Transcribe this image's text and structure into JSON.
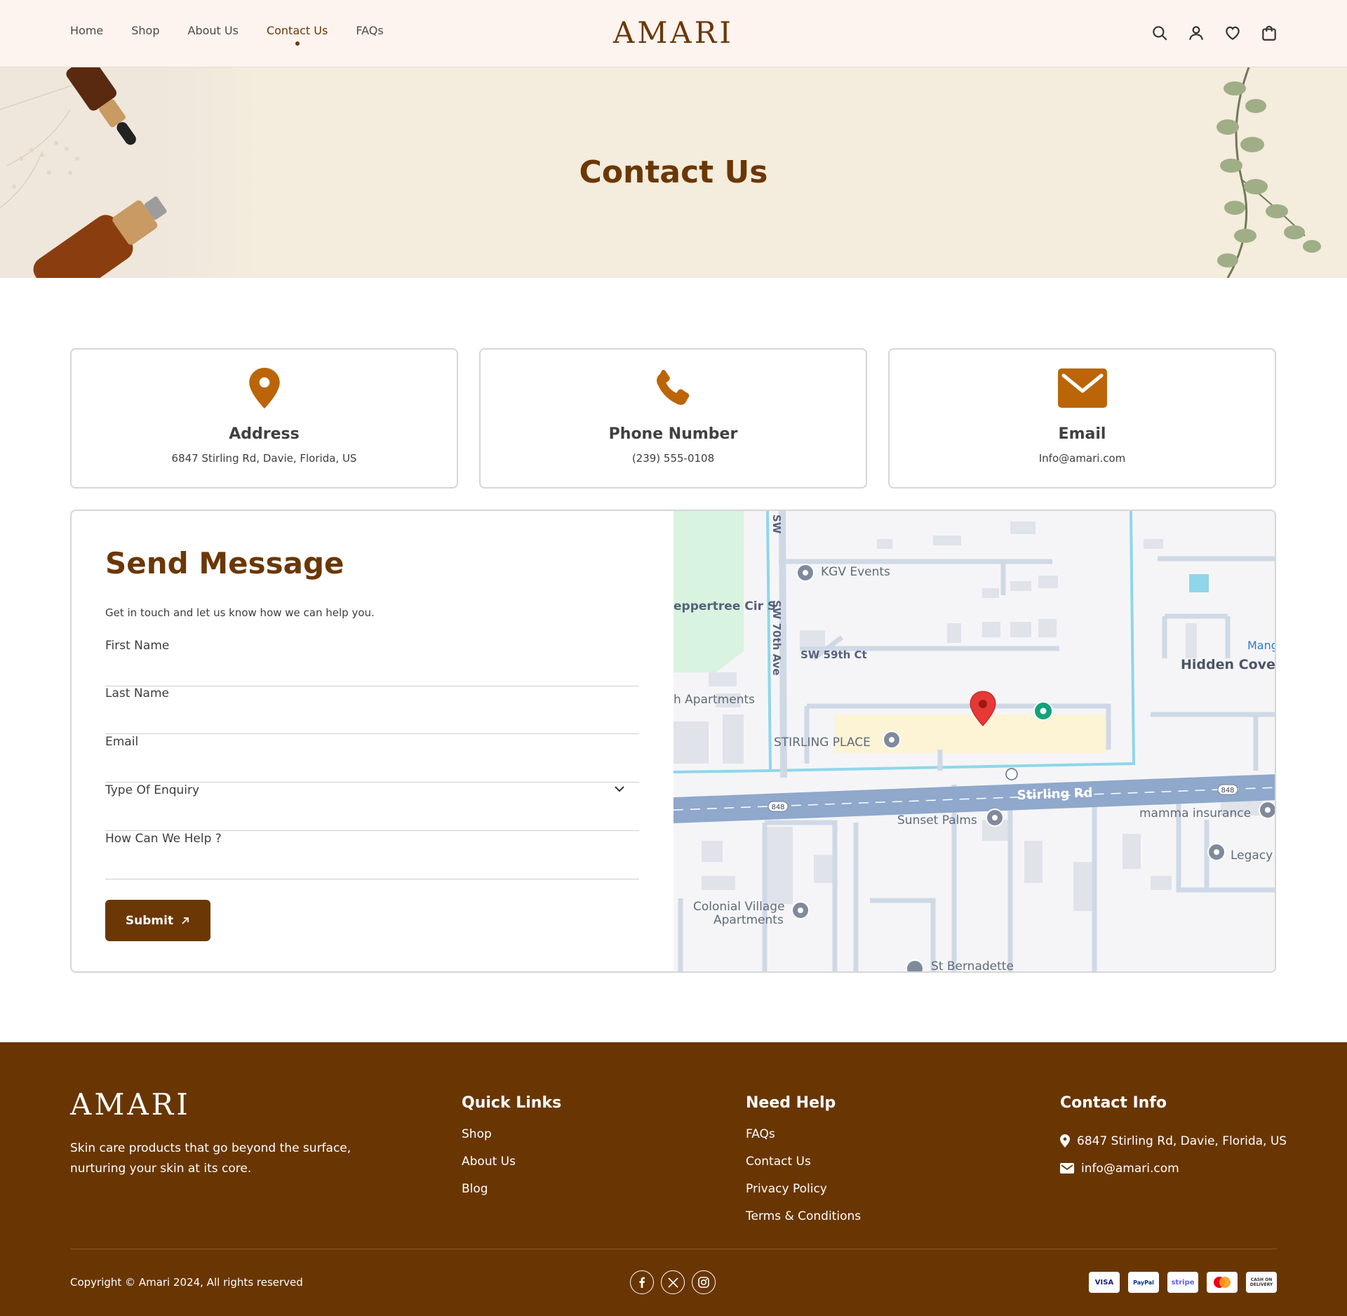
{
  "header": {
    "nav": [
      {
        "label": "Home"
      },
      {
        "label": "Shop"
      },
      {
        "label": "About Us"
      },
      {
        "label": "Contact Us",
        "active": true
      },
      {
        "label": "FAQs"
      }
    ],
    "logo": "AMARI",
    "icons": [
      "search-icon",
      "user-icon",
      "heart-icon",
      "cart-icon"
    ]
  },
  "banner": {
    "title": "Contact Us"
  },
  "cards": [
    {
      "icon": "location-pin-icon",
      "title": "Address",
      "value": "6847 Stirling Rd, Davie, Florida, US"
    },
    {
      "icon": "phone-icon",
      "title": "Phone Number",
      "value": "(239) 555-0108"
    },
    {
      "icon": "envelope-icon",
      "title": "Email",
      "value": "Info@amari.com"
    }
  ],
  "form": {
    "title": "Send Message",
    "subtitle": "Get in touch and let us know how we can help you.",
    "fields": {
      "first_name": "First Name",
      "last_name": "Last Name",
      "email": "Email",
      "enquiry": "Type Of Enquiry",
      "help": "How Can We Help ?"
    },
    "submit": "Submit"
  },
  "map": {
    "labels": {
      "kgv": "KGV Events",
      "peppertree": "eppertree Cir S",
      "sw70": "SW 70th Ave",
      "sw59": "SW 59th Ct",
      "apartments": "h Apartments",
      "stirling_place": "STIRLING PLACE",
      "hidden_cove": "Hidden Cove I",
      "mang": "Mang",
      "stirling_rd": "Stirling Rd",
      "sunset": "Sunset Palms",
      "mamma": "mamma insurance",
      "legacy": "Legacy",
      "colonial1": "Colonial Village",
      "colonial2": "Apartments",
      "bernadette": "St Bernadette",
      "route1": "848",
      "route2": "848",
      "sw_top": "SW"
    }
  },
  "footer": {
    "logo": "AMARI",
    "tagline": "Skin care products that go beyond the surface, nurturing your skin at its core.",
    "quick_links": {
      "title": "Quick Links",
      "items": [
        "Shop",
        "About Us",
        "Blog"
      ]
    },
    "need_help": {
      "title": "Need Help",
      "items": [
        "FAQs",
        "Contact Us",
        "Privacy Policy",
        "Terms & Conditions"
      ]
    },
    "contact": {
      "title": "Contact Info",
      "address": "6847 Stirling Rd, Davie, Florida, US",
      "email": "info@amari.com"
    },
    "copyright": "Copyright © Amari 2024, All rights reserved",
    "socials": [
      "facebook-icon",
      "x-icon",
      "instagram-icon"
    ],
    "payments": {
      "visa": "VISA",
      "paypal": "PayPal",
      "stripe": "stripe",
      "cod1": "CASH ON",
      "cod2": "DELIVERY"
    }
  },
  "colors": {
    "brand": "#6b3705",
    "accent": "#bb6508",
    "header_bg": "#fdf3ef",
    "banner_bg": "#f4ecdc",
    "footer_bg": "#693603"
  }
}
